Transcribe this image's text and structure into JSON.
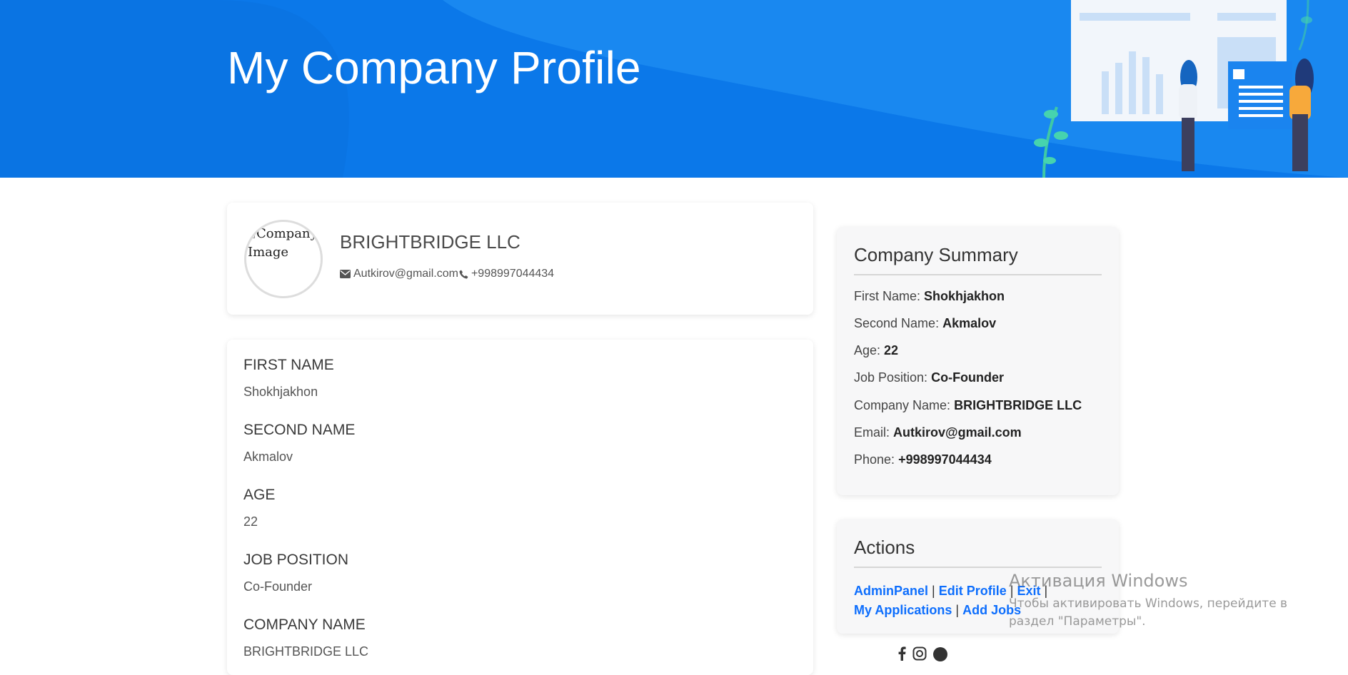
{
  "header": {
    "title": "My Company Profile"
  },
  "profile": {
    "avatar_alt": "Company Image",
    "company_name": "BRIGHTBRIDGE LLC",
    "email": "Autkirov@gmail.com",
    "phone": "+998997044434"
  },
  "details": {
    "fields": [
      {
        "label": "FIRST NAME",
        "value": "Shokhjakhon"
      },
      {
        "label": "SECOND NAME",
        "value": "Akmalov"
      },
      {
        "label": "AGE",
        "value": "22"
      },
      {
        "label": "JOB POSITION",
        "value": "Co-Founder"
      },
      {
        "label": "COMPANY NAME",
        "value": "BRIGHTBRIDGE LLC"
      }
    ]
  },
  "summary": {
    "title": "Company Summary",
    "rows": [
      {
        "label": "First Name:",
        "value": "Shokhjakhon"
      },
      {
        "label": "Second Name:",
        "value": "Akmalov"
      },
      {
        "label": "Age:",
        "value": "22"
      },
      {
        "label": "Job Position:",
        "value": "Co-Founder"
      },
      {
        "label": "Company Name:",
        "value": "BRIGHTBRIDGE LLC"
      },
      {
        "label": "Email:",
        "value": "Autkirov@gmail.com"
      },
      {
        "label": "Phone:",
        "value": "+998997044434"
      }
    ]
  },
  "actions": {
    "title": "Actions",
    "links": {
      "admin_panel": "AdminPanel",
      "edit_profile": "Edit Profile",
      "exit": "Exit",
      "my_applications": "My Applications",
      "add_jobs": "Add Jobs"
    },
    "separator": "|"
  },
  "social_icons": [
    "facebook-icon",
    "instagram-icon",
    "circle-icon"
  ],
  "watermark": {
    "title": "Активация Windows",
    "subtitle": "Чтобы активировать Windows, перейдите в раздел \"Параметры\"."
  },
  "colors": {
    "hero_blue": "#0e80ee",
    "link_blue": "#0d6efd",
    "card_gray": "#f7f7f8"
  }
}
